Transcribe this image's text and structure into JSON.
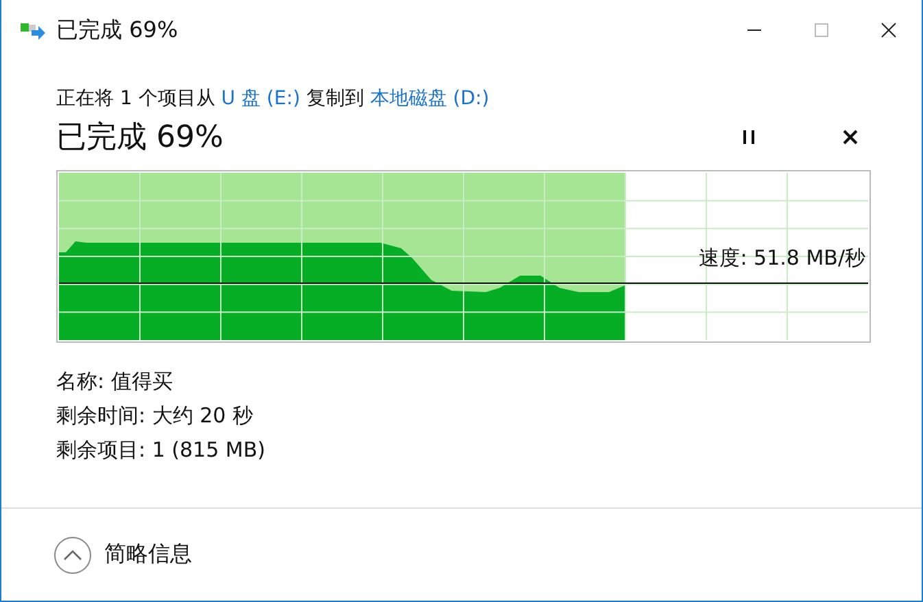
{
  "window": {
    "title": "已完成 69%"
  },
  "source_line": [
    {
      "kind": "text",
      "text": "正在将 1 个项目从"
    },
    {
      "kind": "link",
      "text": "U 盘 (E:)"
    },
    {
      "kind": "text",
      "text": "复制到"
    },
    {
      "kind": "link",
      "text": "本地磁盘 (D:)"
    }
  ],
  "heading": "已完成 69%",
  "progress": {
    "level": 0.7,
    "speed": "速度: 51.8 MB/秒"
  },
  "details": [
    "名称: 值得买",
    "剩余时间: 大约 20 秒",
    "剩余项目: 1 (815 MB)"
  ],
  "footer": {
    "label": "简略信息",
    "expanded": true
  }
}
